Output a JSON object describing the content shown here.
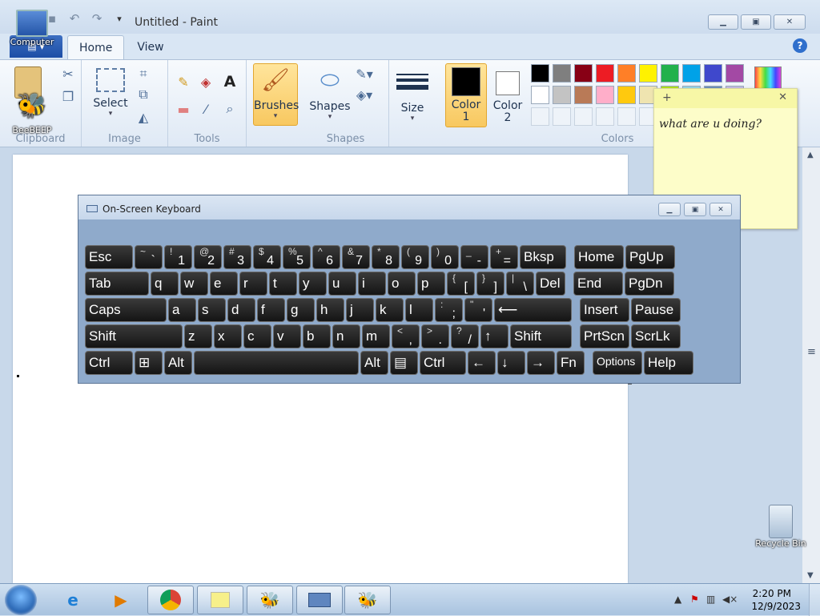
{
  "paint": {
    "title": "Untitled - Paint",
    "tabs": [
      "Home",
      "View"
    ],
    "groups": {
      "clipboard": "Clipboard",
      "image": "Image",
      "tools": "Tools",
      "shapes": "Shapes",
      "colors": "Colors"
    },
    "buttons": {
      "select": "Select",
      "brushes": "Brushes",
      "shapes": "Shapes",
      "size": "Size",
      "color1": "Color\n1",
      "color2": "Color\n2"
    },
    "palette_row1": [
      "#000000",
      "#7f7f7f",
      "#880015",
      "#ed1c24",
      "#ff7f27",
      "#fff200",
      "#22b14c",
      "#00a2e8",
      "#3f48cc",
      "#a349a4"
    ],
    "palette_row2": [
      "#ffffff",
      "#c3c3c3",
      "#b97a57",
      "#ffaec9",
      "#ffc90e",
      "#efe4b0",
      "#b5e61d",
      "#99d9ea",
      "#7092be",
      "#c8bfe7"
    ]
  },
  "desktop": {
    "icons": {
      "computer": "Computer",
      "beebeep": "BeeBEEP",
      "recycle_bin": "Recycle Bin"
    }
  },
  "sticky_note": {
    "text": "what are u doing?"
  },
  "osk": {
    "title": "On-Screen Keyboard",
    "row1": [
      {
        "main": "Esc"
      },
      {
        "sub": "~",
        "main": "`"
      },
      {
        "sub": "!",
        "main": "1"
      },
      {
        "sub": "@",
        "main": "2"
      },
      {
        "sub": "#",
        "main": "3"
      },
      {
        "sub": "$",
        "main": "4"
      },
      {
        "sub": "%",
        "main": "5"
      },
      {
        "sub": "^",
        "main": "6"
      },
      {
        "sub": "&",
        "main": "7"
      },
      {
        "sub": "*",
        "main": "8"
      },
      {
        "sub": "(",
        "main": "9"
      },
      {
        "sub": ")",
        "main": "0"
      },
      {
        "sub": "_",
        "main": "-"
      },
      {
        "sub": "+",
        "main": "="
      },
      {
        "main": "Bksp"
      },
      {
        "main": "Home"
      },
      {
        "main": "PgUp"
      }
    ],
    "row2": [
      {
        "main": "Tab"
      },
      {
        "main": "q"
      },
      {
        "main": "w"
      },
      {
        "main": "e"
      },
      {
        "main": "r"
      },
      {
        "main": "t"
      },
      {
        "main": "y"
      },
      {
        "main": "u"
      },
      {
        "main": "i"
      },
      {
        "main": "o"
      },
      {
        "main": "p"
      },
      {
        "sub": "{",
        "main": "["
      },
      {
        "sub": "}",
        "main": "]"
      },
      {
        "sub": "|",
        "main": "\\"
      },
      {
        "main": "Del"
      },
      {
        "main": "End"
      },
      {
        "main": "PgDn"
      }
    ],
    "row3": [
      {
        "main": "Caps"
      },
      {
        "main": "a"
      },
      {
        "main": "s"
      },
      {
        "main": "d"
      },
      {
        "main": "f"
      },
      {
        "main": "g"
      },
      {
        "main": "h"
      },
      {
        "main": "j"
      },
      {
        "main": "k"
      },
      {
        "main": "l"
      },
      {
        "sub": ":",
        "main": ";"
      },
      {
        "sub": "\"",
        "main": "'"
      },
      {
        "main": "⟵"
      },
      {
        "main": "Insert"
      },
      {
        "main": "Pause"
      }
    ],
    "row4": [
      {
        "main": "Shift"
      },
      {
        "main": "z"
      },
      {
        "main": "x"
      },
      {
        "main": "c"
      },
      {
        "main": "v"
      },
      {
        "main": "b"
      },
      {
        "main": "n"
      },
      {
        "main": "m"
      },
      {
        "sub": "<",
        "main": ","
      },
      {
        "sub": ">",
        "main": "."
      },
      {
        "sub": "?",
        "main": "/"
      },
      {
        "main": "↑"
      },
      {
        "main": "Shift"
      },
      {
        "main": "PrtScn"
      },
      {
        "main": "ScrLk"
      }
    ],
    "row5": [
      {
        "main": "Ctrl"
      },
      {
        "main": "⊞"
      },
      {
        "main": "Alt"
      },
      {
        "main": ""
      },
      {
        "main": "Alt"
      },
      {
        "main": "▤"
      },
      {
        "main": "Ctrl"
      },
      {
        "main": "←"
      },
      {
        "main": "↓"
      },
      {
        "main": "→"
      },
      {
        "main": "Fn"
      },
      {
        "main": "Options"
      },
      {
        "main": "Help"
      }
    ]
  },
  "taskbar": {
    "time": "2:20 PM",
    "date": "12/9/2023"
  }
}
